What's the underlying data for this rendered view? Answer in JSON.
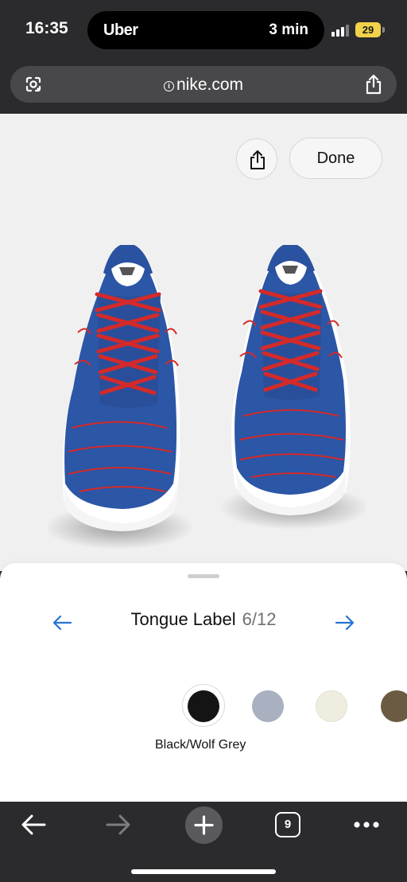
{
  "status_bar": {
    "time": "16:35",
    "live_activity_app": "Uber",
    "live_activity_eta": "3 min",
    "battery": "29",
    "battery_color": "#f2d24a"
  },
  "url_bar": {
    "domain": "nike.com",
    "left_icon": "google-lens-icon",
    "right_icon": "share-icon"
  },
  "viewer": {
    "share_icon": "share-icon",
    "done_label": "Done",
    "shoe_colors": {
      "upper": "#2c56a6",
      "laces": "#d42a2a",
      "sole": "#ffffff"
    }
  },
  "customizer": {
    "option_name": "Tongue Label",
    "option_count": "6/12",
    "accent_color": "#2574d4",
    "selected_swatch_name": "Black/Wolf Grey",
    "swatches": [
      {
        "color": "#141414",
        "selected": true
      },
      {
        "color": "#a9b0bf",
        "selected": false
      },
      {
        "color": "#efede0",
        "selected": false
      },
      {
        "color": "#6b5b43",
        "selected": false
      }
    ]
  },
  "bottom_bar": {
    "tab_count": "9",
    "icons": [
      "back-arrow-icon",
      "forward-arrow-icon",
      "plus-icon",
      "tabs-icon",
      "more-icon"
    ]
  }
}
